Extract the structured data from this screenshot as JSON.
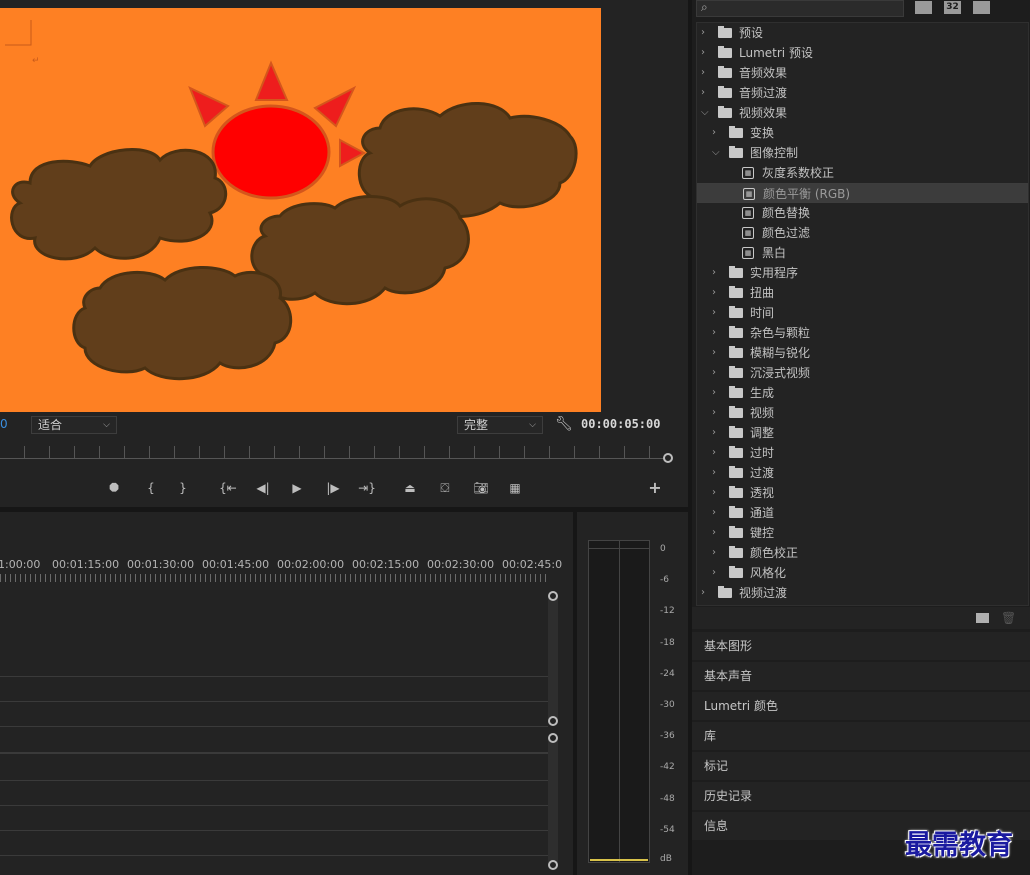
{
  "program_monitor": {
    "timecode_left": "0",
    "fit_select": "适合",
    "quality_select": "完整",
    "duration": "00:00:05:00"
  },
  "transport": {
    "buttons": [
      "add-marker",
      "mark-in",
      "mark-out",
      "go-to-in",
      "step-back",
      "play",
      "step-forward",
      "go-to-out",
      "lift",
      "extract",
      "export-frame",
      "button-editor"
    ],
    "add_label": "+"
  },
  "timeline": {
    "times": [
      "1:00:00",
      "00:01:15:00",
      "00:01:30:00",
      "00:01:45:00",
      "00:02:00:00",
      "00:02:15:00",
      "00:02:30:00",
      "00:02:45:0"
    ]
  },
  "audio_meter": {
    "scale": [
      "0",
      "-6",
      "-12",
      "-18",
      "-24",
      "-30",
      "-36",
      "-42",
      "-48",
      "-54",
      "dB"
    ]
  },
  "effects_panel": {
    "toolbar_icons": [
      "accelerated-effects-icon",
      "32bit-icon",
      "yuv-icon"
    ],
    "toolbar_labels": [
      "",
      "32",
      ""
    ],
    "tree": [
      {
        "label": "预设",
        "level": 0,
        "open": false,
        "kind": "star-folder"
      },
      {
        "label": "Lumetri 预设",
        "level": 0,
        "open": false,
        "kind": "star-folder"
      },
      {
        "label": "音频效果",
        "level": 0,
        "open": false,
        "kind": "folder"
      },
      {
        "label": "音频过渡",
        "level": 0,
        "open": false,
        "kind": "folder"
      },
      {
        "label": "视频效果",
        "level": 0,
        "open": true,
        "kind": "folder"
      },
      {
        "label": "变换",
        "level": 1,
        "open": false,
        "kind": "folder"
      },
      {
        "label": "图像控制",
        "level": 1,
        "open": true,
        "kind": "folder"
      },
      {
        "label": "灰度系数校正",
        "level": 2,
        "kind": "effect"
      },
      {
        "label": "颜色平衡 (RGB)",
        "level": 2,
        "kind": "effect",
        "selected": true
      },
      {
        "label": "颜色替换",
        "level": 2,
        "kind": "effect"
      },
      {
        "label": "颜色过滤",
        "level": 2,
        "kind": "effect"
      },
      {
        "label": "黑白",
        "level": 2,
        "kind": "effect"
      },
      {
        "label": "实用程序",
        "level": 1,
        "open": false,
        "kind": "folder"
      },
      {
        "label": "扭曲",
        "level": 1,
        "open": false,
        "kind": "folder"
      },
      {
        "label": "时间",
        "level": 1,
        "open": false,
        "kind": "folder"
      },
      {
        "label": "杂色与颗粒",
        "level": 1,
        "open": false,
        "kind": "folder"
      },
      {
        "label": "模糊与锐化",
        "level": 1,
        "open": false,
        "kind": "folder"
      },
      {
        "label": "沉浸式视频",
        "level": 1,
        "open": false,
        "kind": "folder"
      },
      {
        "label": "生成",
        "level": 1,
        "open": false,
        "kind": "folder"
      },
      {
        "label": "视频",
        "level": 1,
        "open": false,
        "kind": "folder"
      },
      {
        "label": "调整",
        "level": 1,
        "open": false,
        "kind": "folder"
      },
      {
        "label": "过时",
        "level": 1,
        "open": false,
        "kind": "folder"
      },
      {
        "label": "过渡",
        "level": 1,
        "open": false,
        "kind": "folder"
      },
      {
        "label": "透视",
        "level": 1,
        "open": false,
        "kind": "folder"
      },
      {
        "label": "通道",
        "level": 1,
        "open": false,
        "kind": "folder"
      },
      {
        "label": "键控",
        "level": 1,
        "open": false,
        "kind": "folder"
      },
      {
        "label": "颜色校正",
        "level": 1,
        "open": false,
        "kind": "folder"
      },
      {
        "label": "风格化",
        "level": 1,
        "open": false,
        "kind": "folder"
      },
      {
        "label": "视频过渡",
        "level": 0,
        "open": false,
        "kind": "folder"
      }
    ]
  },
  "panels": [
    "基本图形",
    "基本声音",
    "Lumetri 颜色",
    "库",
    "标记",
    "历史记录",
    "信息"
  ],
  "watermark": "最需教育",
  "colors": {
    "frame_bg": "#fe8023",
    "sun": "#ff0000",
    "sun_rays": "#e8231b",
    "cloud": "#603e1c",
    "accent_blue": "#3a8fe0"
  }
}
